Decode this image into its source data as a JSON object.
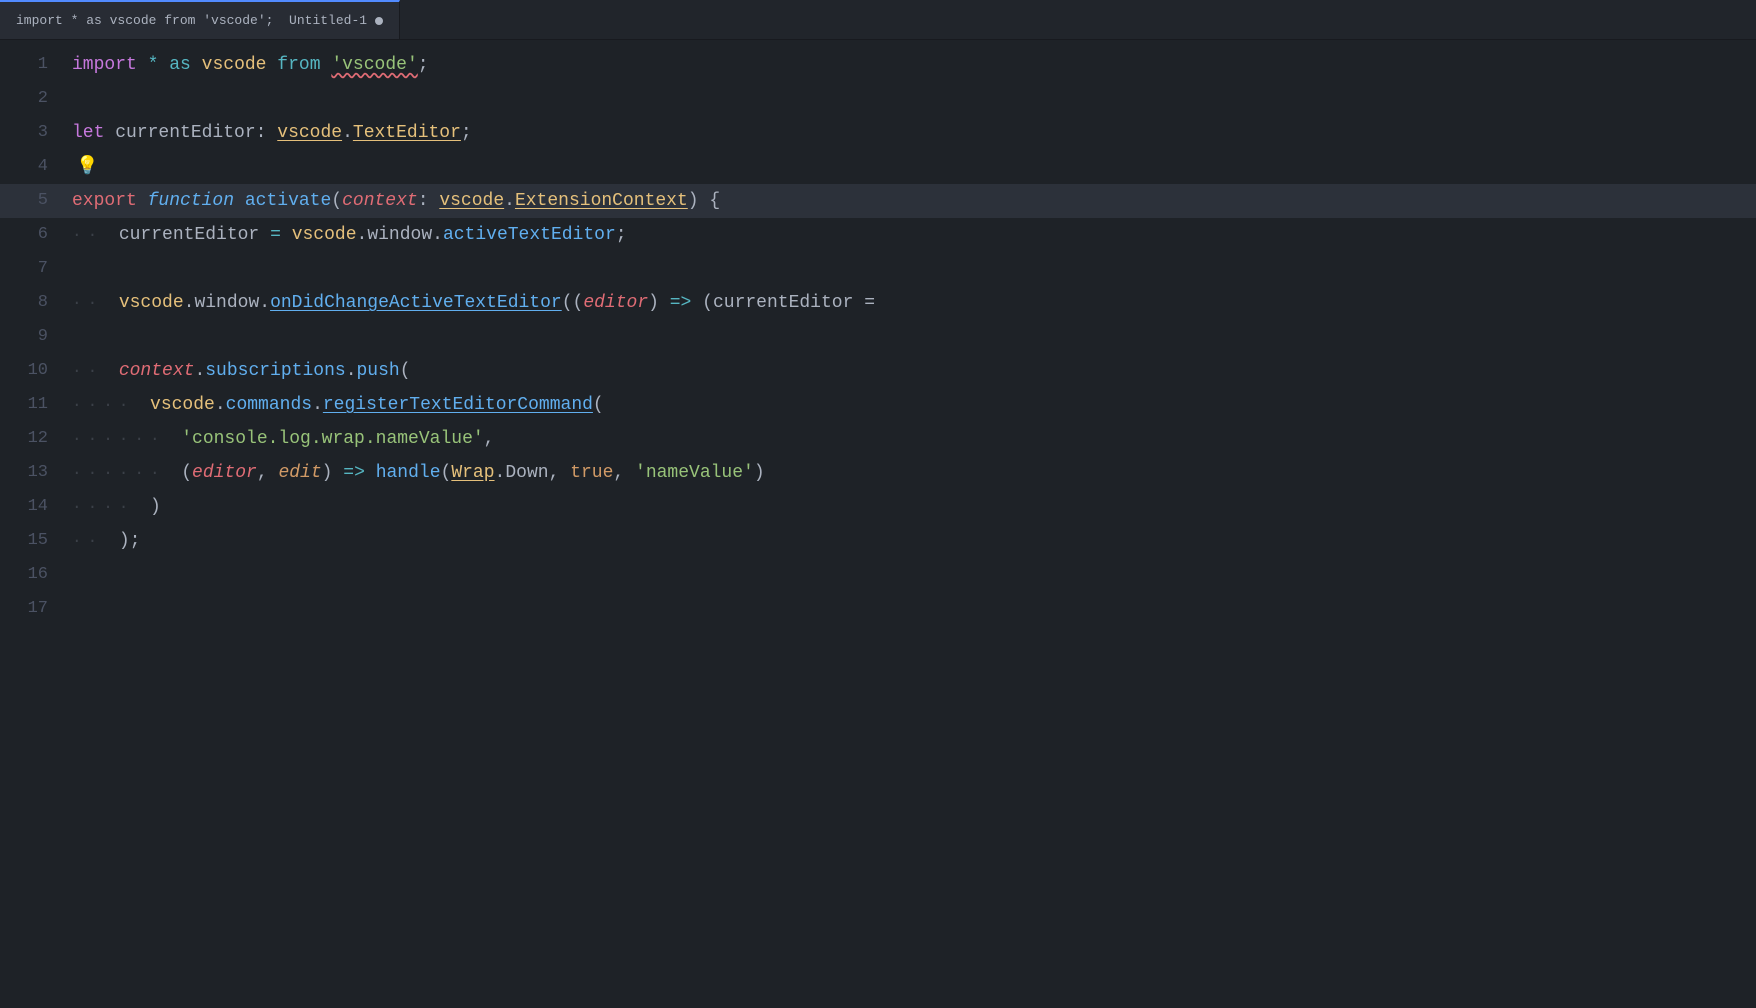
{
  "tab": {
    "title": "import * as vscode from 'vscode';",
    "filename": "Untitled-1",
    "modified": true,
    "dot_char": "●"
  },
  "lines": [
    {
      "num": 1
    },
    {
      "num": 2
    },
    {
      "num": 3
    },
    {
      "num": 4
    },
    {
      "num": 5
    },
    {
      "num": 6
    },
    {
      "num": 7
    },
    {
      "num": 8
    },
    {
      "num": 9
    },
    {
      "num": 10
    },
    {
      "num": 11
    },
    {
      "num": 12
    },
    {
      "num": 13
    },
    {
      "num": 14
    },
    {
      "num": 15
    },
    {
      "num": 16
    },
    {
      "num": 17
    }
  ]
}
